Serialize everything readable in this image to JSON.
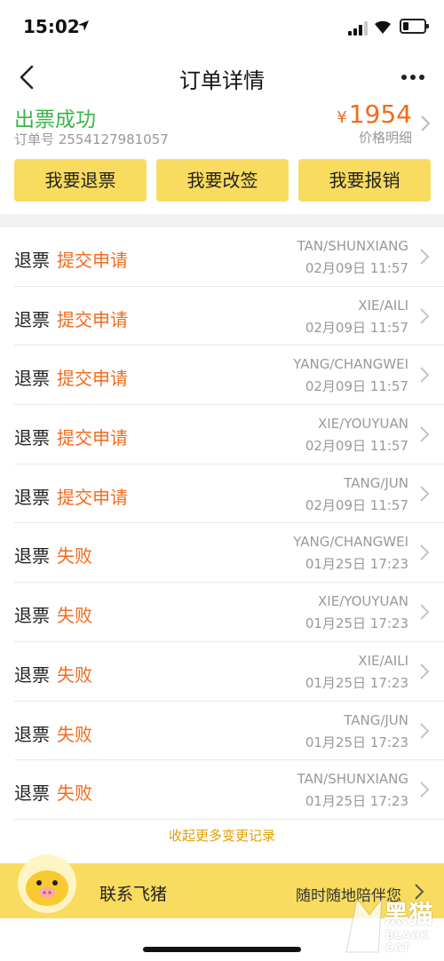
{
  "status_bar": {
    "time": "15:02"
  },
  "nav": {
    "title": "订单详情"
  },
  "order": {
    "status": "出票成功",
    "order_number": "订单号 2554127981057",
    "currency": "¥",
    "price": "1954",
    "price_detail": "价格明细"
  },
  "actions": {
    "refund": "我要退票",
    "change": "我要改签",
    "reimburse": "我要报销"
  },
  "records": [
    {
      "type": "退票",
      "state": "提交申请",
      "name": "TAN/SHUNXIANG",
      "time": "02月09日 11:57"
    },
    {
      "type": "退票",
      "state": "提交申请",
      "name": "XIE/AILI",
      "time": "02月09日 11:57"
    },
    {
      "type": "退票",
      "state": "提交申请",
      "name": "YANG/CHANGWEI",
      "time": "02月09日 11:57"
    },
    {
      "type": "退票",
      "state": "提交申请",
      "name": "XIE/YOUYUAN",
      "time": "02月09日 11:57"
    },
    {
      "type": "退票",
      "state": "提交申请",
      "name": "TANG/JUN",
      "time": "02月09日 11:57"
    },
    {
      "type": "退票",
      "state": "失败",
      "name": "YANG/CHANGWEI",
      "time": "01月25日 17:23"
    },
    {
      "type": "退票",
      "state": "失败",
      "name": "XIE/YOUYUAN",
      "time": "01月25日 17:23"
    },
    {
      "type": "退票",
      "state": "失败",
      "name": "XIE/AILI",
      "time": "01月25日 17:23"
    },
    {
      "type": "退票",
      "state": "失败",
      "name": "TANG/JUN",
      "time": "01月25日 17:23"
    },
    {
      "type": "退票",
      "state": "失败",
      "name": "TAN/SHUNXIANG",
      "time": "01月25日 17:23"
    }
  ],
  "collapse_link": "收起更多变更记录",
  "bottom_bar": {
    "contact": "联系飞猪",
    "slogan": "随时随地陪伴您"
  },
  "watermark": {
    "text": "黑猫",
    "sub": "BLACK CAT"
  },
  "colors": {
    "accent_yellow": "#f9dc5f",
    "success_green": "#3bb54a",
    "price_orange": "#f26b1d",
    "link_gold": "#e2a100"
  }
}
